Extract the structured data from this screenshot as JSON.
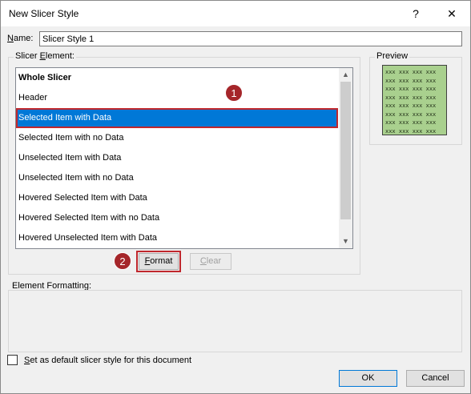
{
  "window": {
    "title": "New Slicer Style",
    "help_glyph": "?",
    "close_glyph": "✕"
  },
  "name_field": {
    "label": "Name:",
    "value": "Slicer Style 1"
  },
  "slicer_element": {
    "legend": "Slicer Element:",
    "items": [
      {
        "label": "Whole Slicer",
        "bold": true
      },
      {
        "label": "Header"
      },
      {
        "label": "Selected Item with Data",
        "selected": true
      },
      {
        "label": "Selected Item with no Data"
      },
      {
        "label": "Unselected Item with Data"
      },
      {
        "label": "Unselected Item with no Data"
      },
      {
        "label": "Hovered Selected Item with Data"
      },
      {
        "label": "Hovered Selected Item with no Data"
      },
      {
        "label": "Hovered Unselected Item with Data"
      }
    ],
    "scroll_up_glyph": "▲",
    "scroll_down_glyph": "▼"
  },
  "buttons": {
    "format": "Format",
    "clear": "Clear",
    "ok": "OK",
    "cancel": "Cancel"
  },
  "preview": {
    "legend": "Preview",
    "cell_text": "xxx",
    "fill_color": "#a9d08e"
  },
  "element_formatting": {
    "legend": "Element Formatting:"
  },
  "default_checkbox": {
    "label": "Set as default slicer style for this document",
    "checked": false
  },
  "annotations": {
    "step1": "1",
    "step2": "2",
    "marker_color": "#a5262a"
  },
  "colors": {
    "selection": "#0078d7",
    "highlight_outline": "#c0272d"
  }
}
